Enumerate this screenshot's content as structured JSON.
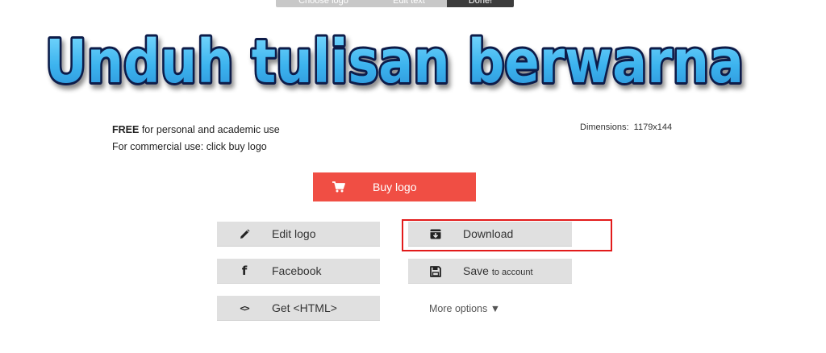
{
  "stepper": {
    "steps": [
      "Choose logo",
      "Edit text",
      "Done!"
    ],
    "active_index": 2
  },
  "logo": {
    "text": "Unduh tulisan berwarna",
    "fill_color": "#4fc3f2",
    "outline_color": "#0a1a4a"
  },
  "info": {
    "free_strong": "FREE",
    "free_rest": " for personal and academic use",
    "commercial": "For commercial use: click buy logo",
    "dimensions_label": "Dimensions:",
    "dimensions_value": "1179x144"
  },
  "buttons": {
    "buy": {
      "label": "Buy logo",
      "icon": "cart-icon"
    },
    "edit": {
      "label": "Edit logo",
      "icon": "pencil-icon"
    },
    "facebook": {
      "label": "Facebook",
      "icon": "facebook-icon"
    },
    "html": {
      "label": "Get <HTML>",
      "icon": "code-icon",
      "glyph": "<>"
    },
    "download": {
      "label": "Download",
      "icon": "download-box-icon"
    },
    "save": {
      "label": "Save",
      "suffix": "to account",
      "icon": "floppy-disk-icon"
    }
  },
  "more_options": {
    "label": "More options",
    "caret": "▼"
  },
  "colors": {
    "buy_button": "#f04e44",
    "secondary_button": "#e0e0e0",
    "highlight_border": "#e21b1b",
    "active_step": "#3c3c3c",
    "inactive_step": "#c8c8c8"
  }
}
